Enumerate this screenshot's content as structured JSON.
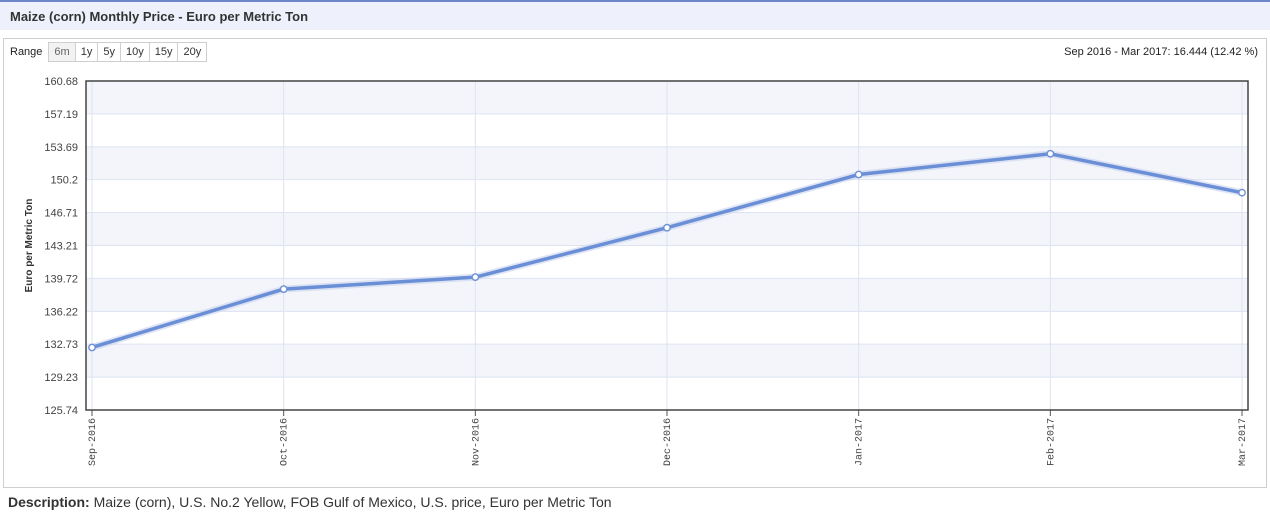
{
  "page": {
    "title": "Maize (corn) Monthly Price - Euro per Metric Ton",
    "range_label": "Range",
    "range_options": [
      "6m",
      "1y",
      "5y",
      "10y",
      "15y",
      "20y"
    ],
    "range_selected": "6m",
    "summary": "Sep 2016 - Mar 2017: 16.444 (12.42 %)",
    "description_label": "Description:",
    "description_text": "Maize (corn), U.S. No.2 Yellow, FOB Gulf of Mexico, U.S. price, Euro per Metric Ton"
  },
  "chart_data": {
    "type": "line",
    "title": "",
    "xlabel": "",
    "ylabel": "Euro per Metric Ton",
    "categories": [
      "Sep-2016",
      "Oct-2016",
      "Nov-2016",
      "Dec-2016",
      "Jan-2017",
      "Feb-2017",
      "Mar-2017"
    ],
    "series": [
      {
        "values": [
          132.38,
          138.58,
          139.85,
          145.1,
          150.75,
          152.95,
          148.82
        ]
      }
    ],
    "y_ticks": [
      "125.74",
      "129.23",
      "132.73",
      "136.22",
      "139.72",
      "143.21",
      "146.71",
      "150.2",
      "153.69",
      "157.19",
      "160.68"
    ],
    "ylim": [
      125.74,
      160.68
    ],
    "grid": true,
    "line_color": "#6b8fd6"
  }
}
